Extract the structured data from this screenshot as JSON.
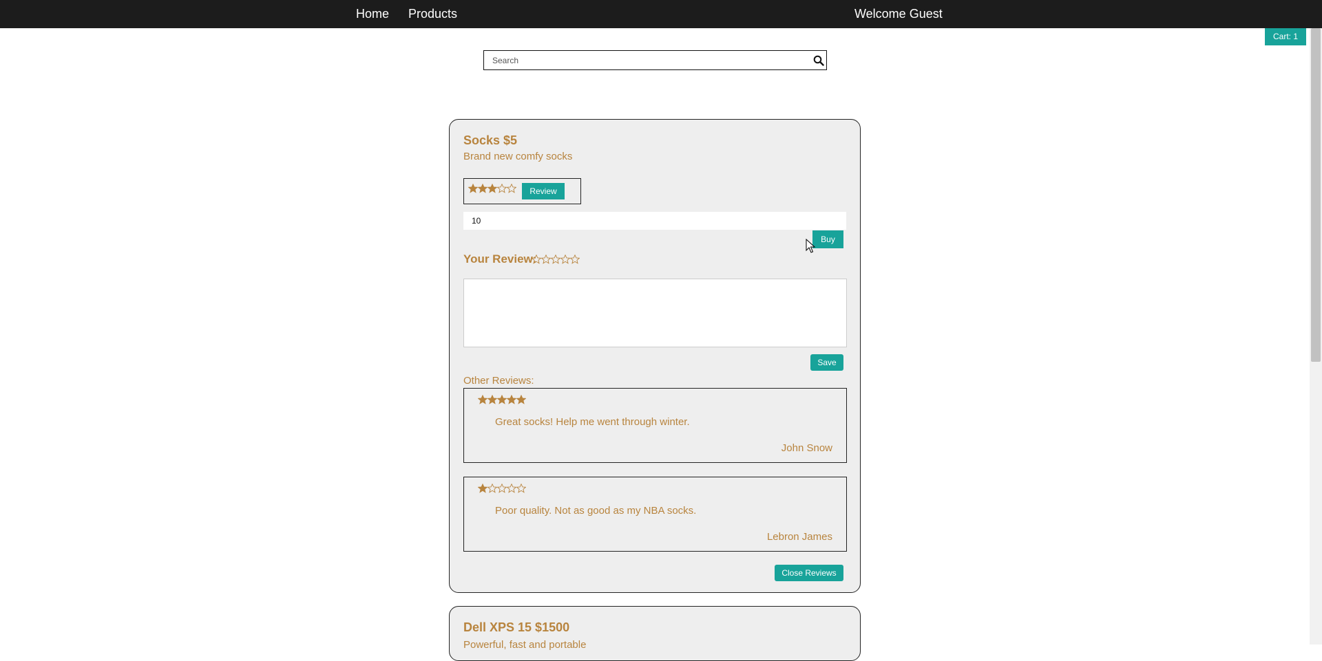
{
  "nav": {
    "home_label": "Home",
    "products_label": "Products",
    "welcome_text": "Welcome Guest",
    "cart_label": "Cart: 1"
  },
  "search": {
    "placeholder": "Search",
    "value": ""
  },
  "colors": {
    "accent": "#18a39a",
    "text_gold": "#b8843e",
    "topbar": "#1c1c1c",
    "card_bg": "#eeeeee"
  },
  "products": [
    {
      "title": "Socks $5",
      "description": "Brand new comfy socks",
      "rating": 3,
      "review_button": "Review",
      "quantity": "10",
      "buy_button": "Buy",
      "your_review_label": "Your Review:",
      "your_review_rating": 0,
      "review_text_value": "",
      "save_button": "Save",
      "other_reviews_label": "Other Reviews:",
      "reviews": [
        {
          "rating": 5,
          "text": "Great socks! Help me went through winter.",
          "author": "John Snow"
        },
        {
          "rating": 1,
          "text": "Poor quality. Not as good as my NBA socks.",
          "author": "Lebron James"
        }
      ],
      "close_reviews_button": "Close Reviews"
    },
    {
      "title": "Dell XPS 15 $1500",
      "description": "Powerful, fast and portable"
    }
  ]
}
